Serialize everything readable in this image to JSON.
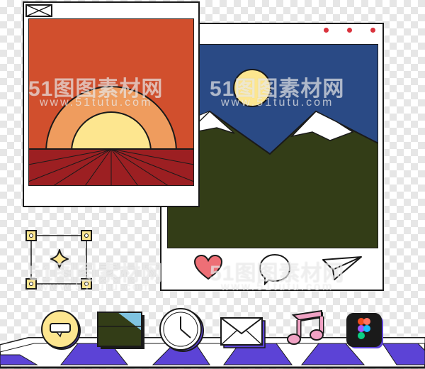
{
  "watermark": {
    "brand": "51图图素材网",
    "url": "www.51tutu.com"
  },
  "colors": {
    "outline": "#1a1a1a",
    "sunset_sky": "#d14f2d",
    "sun_outer": "#ef9c5e",
    "sun_inner": "#fde68f",
    "ground": "#9c1f22",
    "night_sky": "#2a4a85",
    "mountain": "#333d17",
    "snow": "#ffffff",
    "moon": "#fde68f",
    "heart": "#ee6f76",
    "dot_red": "#d9323c",
    "purple": "#5c43d6",
    "chat_yellow": "#fde68f",
    "music_pink": "#f0a2c4"
  },
  "left_photo": {
    "close_icon": "x-box-icon",
    "scene": "sunset"
  },
  "right_photo": {
    "scene": "mountains-moon",
    "window_dots": [
      "dot",
      "dot",
      "dot"
    ],
    "actions": [
      "heart-icon",
      "comment-icon",
      "send-icon"
    ]
  },
  "selection_tool": {
    "icon": "sparkle-icon"
  },
  "dock": {
    "items": [
      "chat-app-icon",
      "gallery-app-icon",
      "clock-app-icon",
      "mail-app-icon",
      "music-app-icon",
      "figma-app-icon"
    ]
  }
}
